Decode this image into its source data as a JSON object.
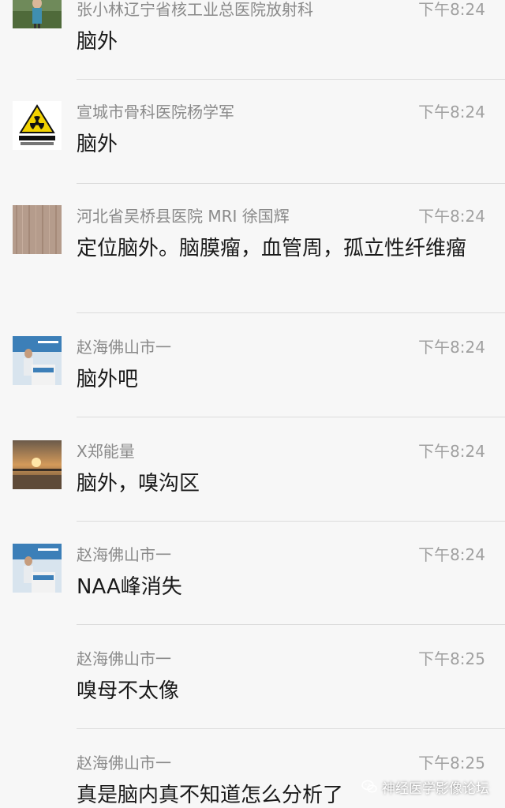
{
  "messages": [
    {
      "sender": "张小林辽宁省核工业总医院放射科",
      "time": "下午8:24",
      "text": "脑外"
    },
    {
      "sender": "宣城市骨科医院杨学军",
      "time": "下午8:24",
      "text": "脑外",
      "avatar_caption": "当心电离辐射"
    },
    {
      "sender": "河北省吴桥县医院  MRI  徐国辉",
      "time": "下午8:24",
      "text": "定位脑外。脑膜瘤，血管周，孤立性纤维瘤"
    },
    {
      "sender": "赵海佛山市一",
      "time": "下午8:24",
      "text": "脑外吧"
    },
    {
      "sender": "X郑能量",
      "time": "下午8:24",
      "text": "脑外，嗅沟区"
    },
    {
      "sender": "赵海佛山市一",
      "time": "下午8:24",
      "text": "NAA峰消失"
    },
    {
      "sender": "赵海佛山市一",
      "time": "下午8:25",
      "text": "嗅母不太像"
    },
    {
      "sender": "赵海佛山市一",
      "time": "下午8:25",
      "text": "真是脑内真不知道怎么分析了"
    }
  ],
  "watermark": {
    "text": "神经医学影像论坛",
    "icon": "wechat-icon"
  },
  "colors": {
    "background": "#f7f7f7",
    "sender": "#8a8a8a",
    "time": "#a0a0a0",
    "text": "#1a1a1a",
    "divider": "#dcdcdc"
  }
}
